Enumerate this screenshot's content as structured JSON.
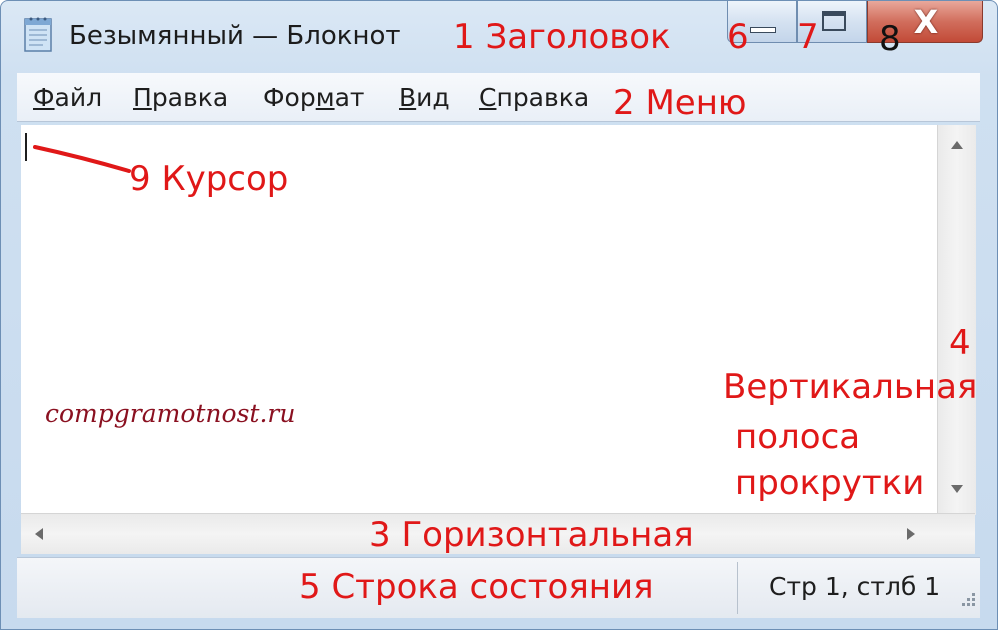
{
  "window": {
    "title": "Безымянный — Блокнот"
  },
  "menu": {
    "items": [
      {
        "pre": "",
        "accel": "Ф",
        "post": "айл"
      },
      {
        "pre": "",
        "accel": "П",
        "post": "равка"
      },
      {
        "pre": "Фор",
        "accel": "м",
        "post": "ат"
      },
      {
        "pre": "",
        "accel": "В",
        "post": "ид"
      },
      {
        "pre": "",
        "accel": "С",
        "post": "правка"
      }
    ]
  },
  "caption": {
    "close_glyph": "X"
  },
  "status": {
    "position": "Стр 1, стлб 1"
  },
  "editor": {
    "watermark": "compgramotnost.ru"
  },
  "annotations": {
    "title": "1 Заголовок",
    "menu": "2 Меню",
    "hscroll": "3 Горизонтальная",
    "vscroll_num": "4",
    "vscroll_l1": "Вертикальная",
    "vscroll_l2": "полоса",
    "vscroll_l3": "прокрутки",
    "status": "5 Строка состояния",
    "minimize": "6",
    "maximize": "7",
    "close": "8",
    "cursor": "9 Курсор"
  },
  "colors": {
    "annotation": "#e01818",
    "watermark": "#8a1020",
    "close_button": "#c24a37"
  },
  "icons": {
    "app": "notepad-icon",
    "minimize": "minimize-icon",
    "maximize": "maximize-icon",
    "close": "close-icon",
    "scroll_up": "arrow-up-icon",
    "scroll_down": "arrow-down-icon",
    "scroll_left": "arrow-left-icon",
    "scroll_right": "arrow-right-icon",
    "grip": "resize-grip-icon"
  }
}
